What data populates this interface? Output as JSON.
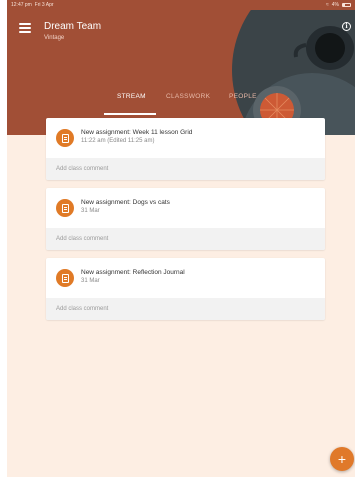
{
  "status_bar": {
    "time": "12:47 pm",
    "date": "Fri 3 Apr",
    "battery": "4%"
  },
  "header": {
    "title": "Dream Team",
    "subtitle": "Vintage",
    "menu_icon": "hamburger-menu-icon",
    "info_icon": "info-icon",
    "info_glyph": "i"
  },
  "tabs": [
    {
      "label": "STREAM",
      "active": true
    },
    {
      "label": "CLASSWORK",
      "active": false
    },
    {
      "label": "PEOPLE",
      "active": false
    }
  ],
  "stream": {
    "items": [
      {
        "title": "New assignment: Week 11 lesson Grid",
        "time": "11:22 am (Edited 11:25 am)",
        "comment_placeholder": "Add class comment"
      },
      {
        "title": "New assignment: Dogs vs cats",
        "time": "31 Mar",
        "comment_placeholder": "Add class comment"
      },
      {
        "title": "New assignment: Reflection Journal",
        "time": "31 Mar",
        "comment_placeholder": "Add class comment"
      }
    ]
  },
  "fab": {
    "label": "+"
  },
  "colors": {
    "header": "#a14f36",
    "background": "#fdeee3",
    "accent": "#e07a26"
  }
}
